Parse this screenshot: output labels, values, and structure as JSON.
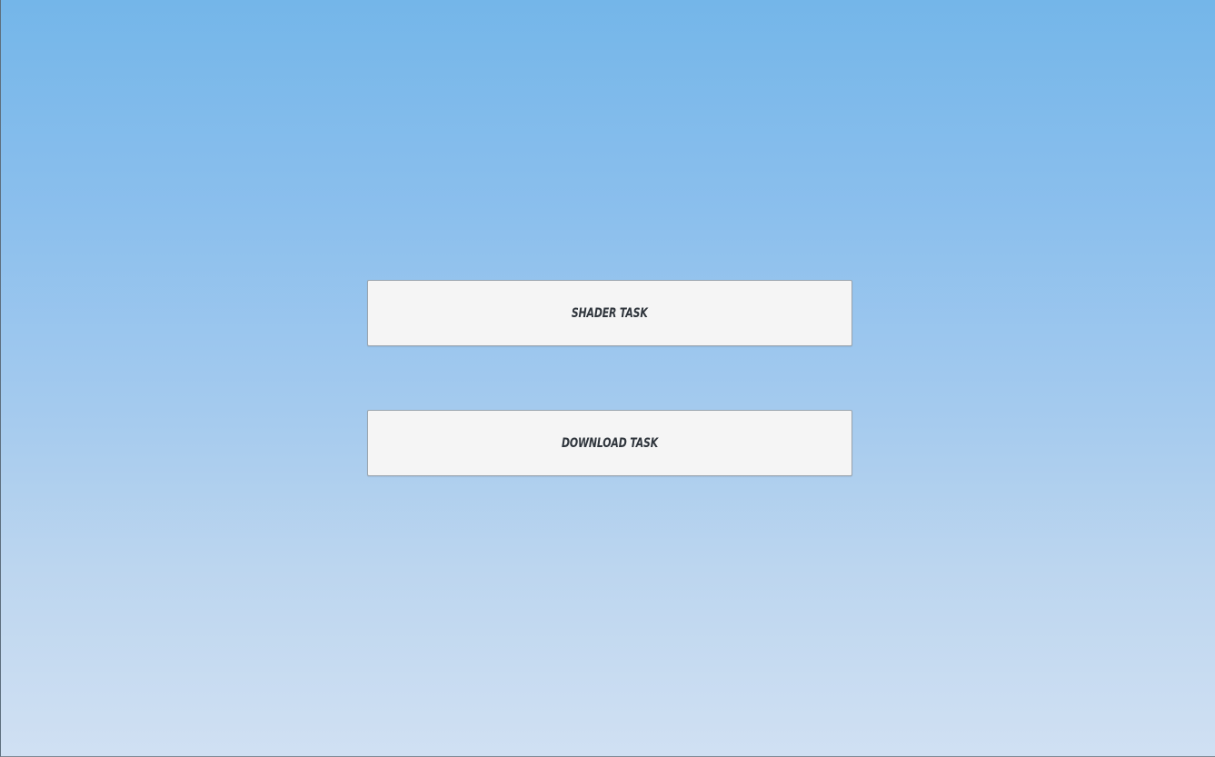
{
  "buttons": {
    "shader_task_label": "SHADER TASK",
    "download_task_label": "DOWNLOAD TASK"
  },
  "colors": {
    "background_top": "#74b6e9",
    "background_bottom": "#d0e0f3",
    "button_fill": "#f5f5f5",
    "button_text": "#2f353c",
    "button_border": "#9aa4ad"
  }
}
